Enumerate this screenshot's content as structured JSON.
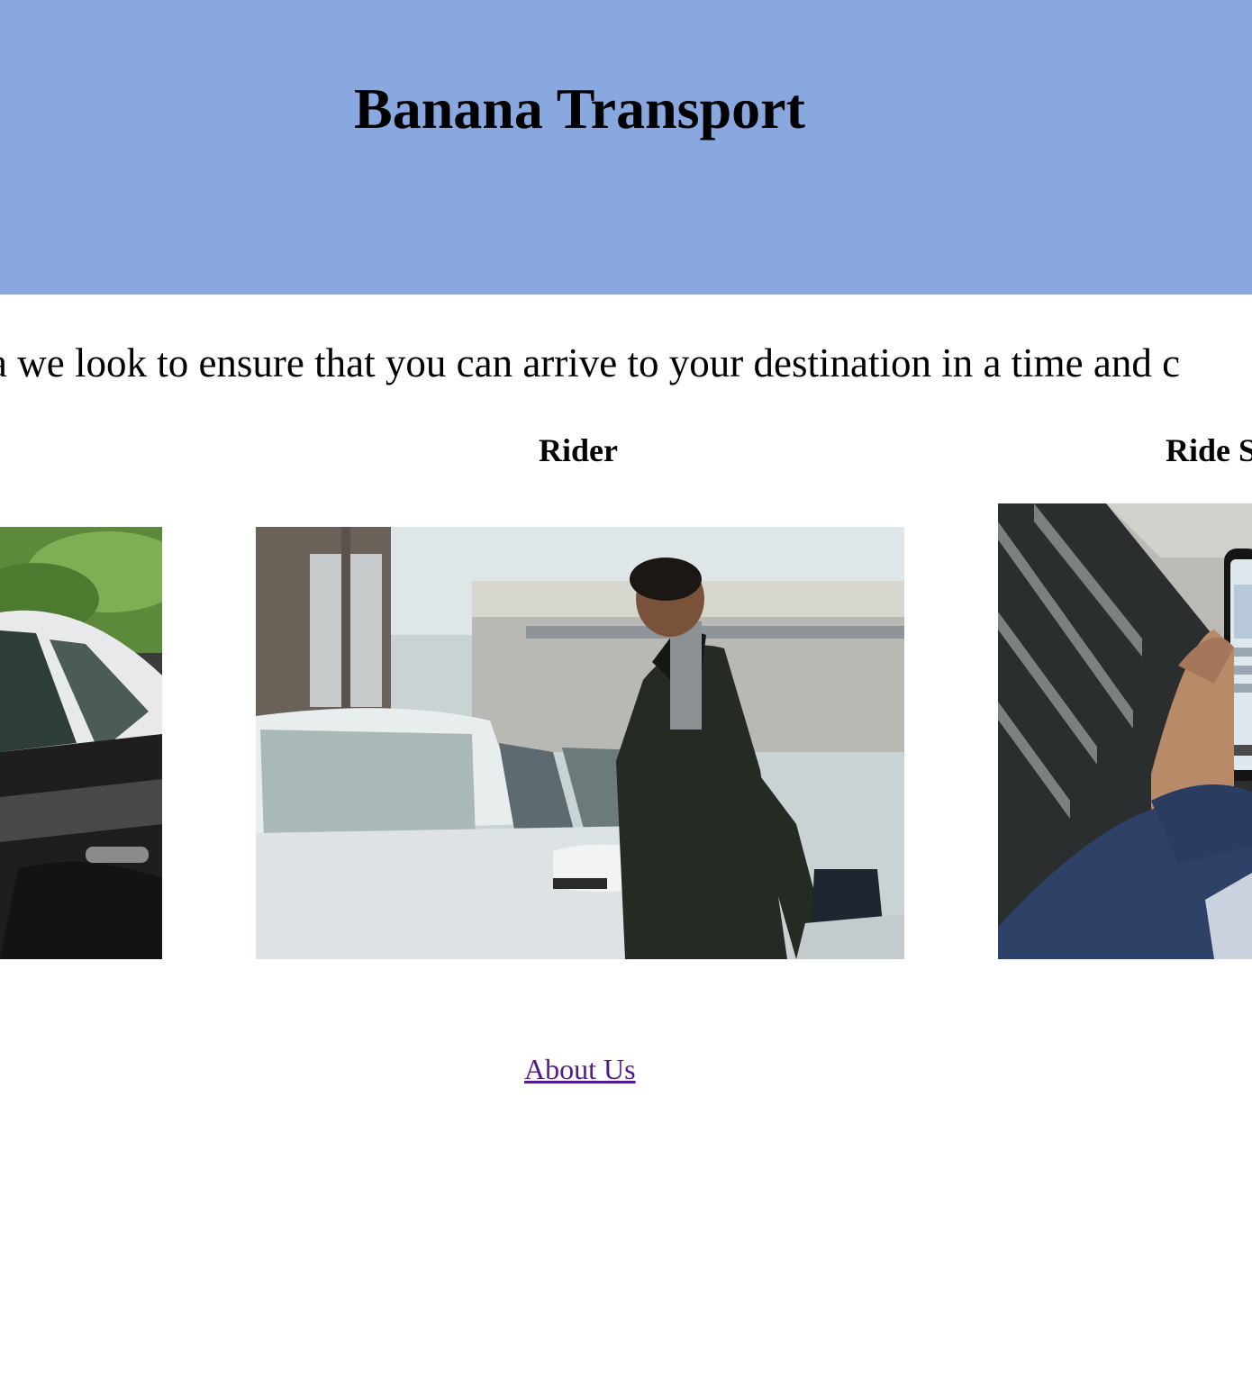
{
  "header": {
    "title": "Banana Transport",
    "background_color": "#8aa8e0"
  },
  "tagline": "a we look to ensure that you can arrive to your destination in a time and c",
  "sections": [
    {
      "heading": "",
      "image": "driver-car-photo"
    },
    {
      "heading": "Rider",
      "image": "rider-entering-car-photo"
    },
    {
      "heading": "Ride S",
      "image": "ride-share-phone-photo"
    }
  ],
  "footer": {
    "about_link": "About Us",
    "link_color": "#551a8b"
  }
}
